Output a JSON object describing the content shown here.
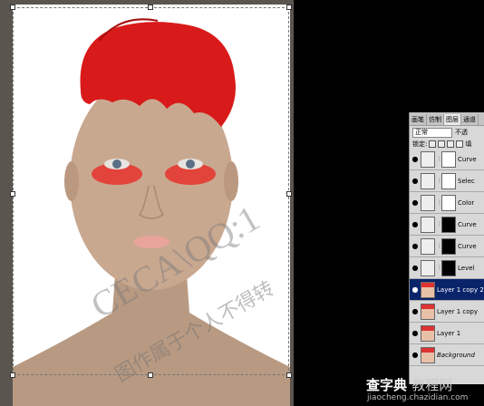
{
  "canvas": {
    "watermark_line1": "CECA\\QQ:1",
    "watermark_line2": "图作属于个人不得转"
  },
  "layers_panel": {
    "tabs": [
      "画笔",
      "仿制",
      "图层",
      "通道"
    ],
    "active_tab_index": 2,
    "blend_mode": "正常",
    "opacity_label": "不透",
    "lock_label": "锁定:",
    "fill_label": "填",
    "layers": [
      {
        "name": "Curve",
        "kind": "curves",
        "mask": "white",
        "visible": true,
        "selected": false
      },
      {
        "name": "Selec",
        "kind": "selective",
        "mask": "white",
        "visible": true,
        "selected": false
      },
      {
        "name": "Color",
        "kind": "color",
        "mask": "white",
        "visible": true,
        "selected": false
      },
      {
        "name": "Curve",
        "kind": "curves",
        "mask": "black",
        "visible": true,
        "selected": false
      },
      {
        "name": "Curve",
        "kind": "curves",
        "mask": "black",
        "visible": true,
        "selected": false
      },
      {
        "name": "Level",
        "kind": "levels",
        "mask": "black",
        "visible": true,
        "selected": false
      },
      {
        "name": "Layer 1 copy 2",
        "kind": "photo",
        "mask": "",
        "visible": true,
        "selected": true
      },
      {
        "name": "Layer 1 copy",
        "kind": "photo",
        "mask": "",
        "visible": true,
        "selected": false
      },
      {
        "name": "Layer 1",
        "kind": "photo",
        "mask": "",
        "visible": true,
        "selected": false
      },
      {
        "name": "Background",
        "kind": "photo",
        "mask": "",
        "visible": true,
        "selected": false,
        "italic": true
      }
    ]
  },
  "site": {
    "logo_main": "查字典",
    "logo_sub": "教程网",
    "url": "jiaocheng.chazidian.com"
  },
  "colors": {
    "selected_layer": "#0a246a",
    "feather_red": "#d91a1a"
  }
}
